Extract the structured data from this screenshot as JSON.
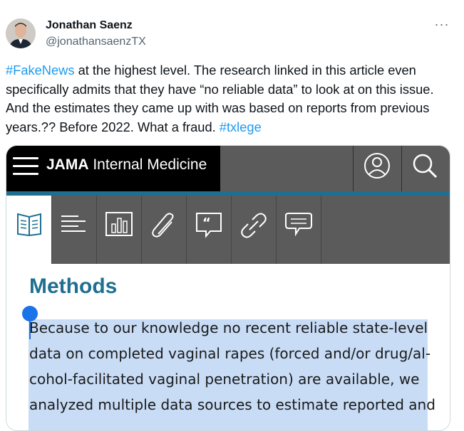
{
  "tweet": {
    "author_name": "Jonathan Saenz",
    "author_handle": "@jonathansaenzTX",
    "more_glyph": "···",
    "text_parts": {
      "tag1": "#FakeNews",
      "body": " at the highest level. The research linked in this article even specifically admits that they have “no reliable data” to look at on this issue. And the estimates they came up with was based on reports from previous years.?? Before 2022. What a fraud. ",
      "tag2": "#txlege"
    }
  },
  "media": {
    "brand_bold": "JAMA",
    "brand_rest": " Internal Medicine",
    "heading": "Methods",
    "lines": [
      "Because to our knowledge no recent reliable state-level",
      "data on completed vaginal rapes (forced and/or drug/al-",
      "cohol-facilitated vaginal penetration) are available, we",
      "analyzed multiple data sources to estimate reported and"
    ],
    "tabs": [
      "article-icon",
      "text-icon",
      "bar-chart-icon",
      "paperclip-icon",
      "quote-icon",
      "link-icon",
      "comment-icon"
    ],
    "colors": {
      "jama_teal": "#1f6f90",
      "tag_blue": "#1d9bf0",
      "selection": "#c8dcf6"
    }
  }
}
